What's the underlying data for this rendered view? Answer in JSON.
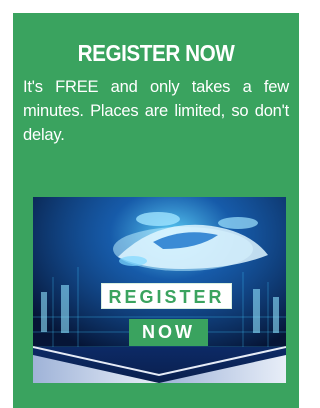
{
  "promo": {
    "title": "REGISTER NOW",
    "description": "It's FREE and only takes a few minutes. Places are limited, so don't delay.",
    "banner": {
      "button_line1": "REGISTER",
      "button_line2": "NOW"
    }
  },
  "colors": {
    "panel_green": "#3aa35f",
    "text_white": "#ffffff",
    "banner_navy": "#081a3d",
    "banner_cyan": "#3fc8ff"
  }
}
